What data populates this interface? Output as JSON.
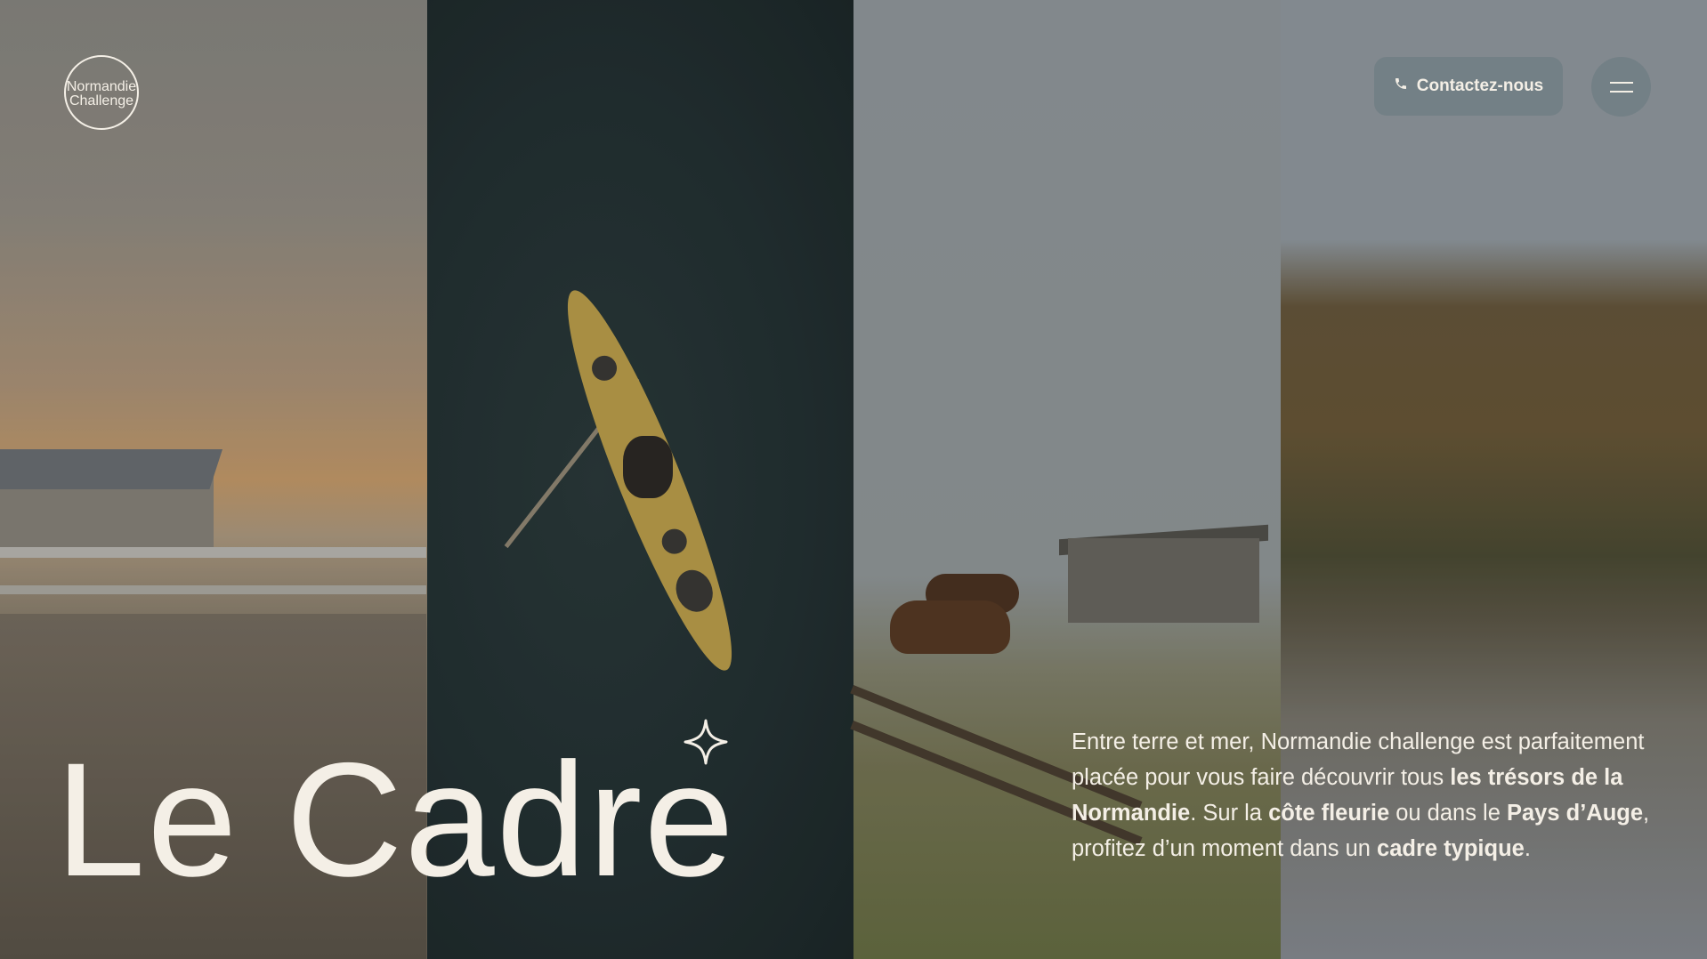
{
  "brand": {
    "logo_line1": "Normandie",
    "logo_line2": "Challenge"
  },
  "header": {
    "contact_label": "Contactez-nous",
    "contact_icon": "phone-icon",
    "menu_icon": "hamburger-menu-icon"
  },
  "hero": {
    "title": "Le Cadre",
    "decoration_icon": "sparkle-star-icon",
    "paragraph": {
      "p1": "Entre terre et mer, Normandie challenge est parfaitement placée pour vous faire découvrir tous ",
      "b1": "les trésors de la Normandie",
      "p2": ". Sur la ",
      "b2": "côte fleurie",
      "p3": " ou dans le ",
      "b3": "Pays d’Auge",
      "p4": ", profitez d’un moment dans un ",
      "b4": "cadre typique",
      "p5": "."
    }
  },
  "colors": {
    "text": "#f4efe6",
    "button_bg": "#6e7d82"
  }
}
